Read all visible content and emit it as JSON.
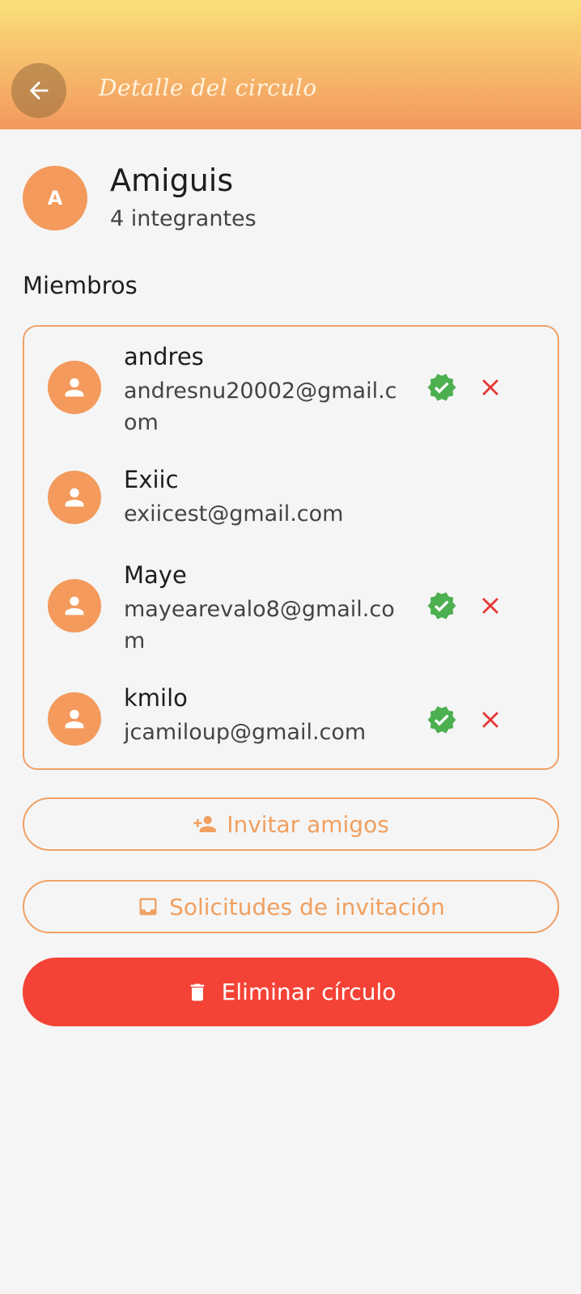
{
  "appbar": {
    "title": "Detalle del circulo"
  },
  "circle": {
    "initial": "A",
    "name": "Amiguis",
    "members_count": "4 integrantes"
  },
  "section": {
    "members_title": "Miembros"
  },
  "members": [
    {
      "name": "andres",
      "email": "andresnu20002@gmail.com",
      "verified": true,
      "removable": true
    },
    {
      "name": "Exiic",
      "email": "exiicest@gmail.com",
      "verified": false,
      "removable": false
    },
    {
      "name": "Maye",
      "email": "mayearevalo8@gmail.com",
      "verified": true,
      "removable": true
    },
    {
      "name": "kmilo",
      "email": "jcamiloup@gmail.com",
      "verified": true,
      "removable": true
    }
  ],
  "actions": {
    "invite_label": "Invitar amigos",
    "requests_label": "Solicitudes de invitación",
    "delete_label": "Eliminar círculo"
  },
  "colors": {
    "accent": "#f39a5c",
    "verified": "#4caf50",
    "danger": "#f44336",
    "remove": "#e53935"
  }
}
